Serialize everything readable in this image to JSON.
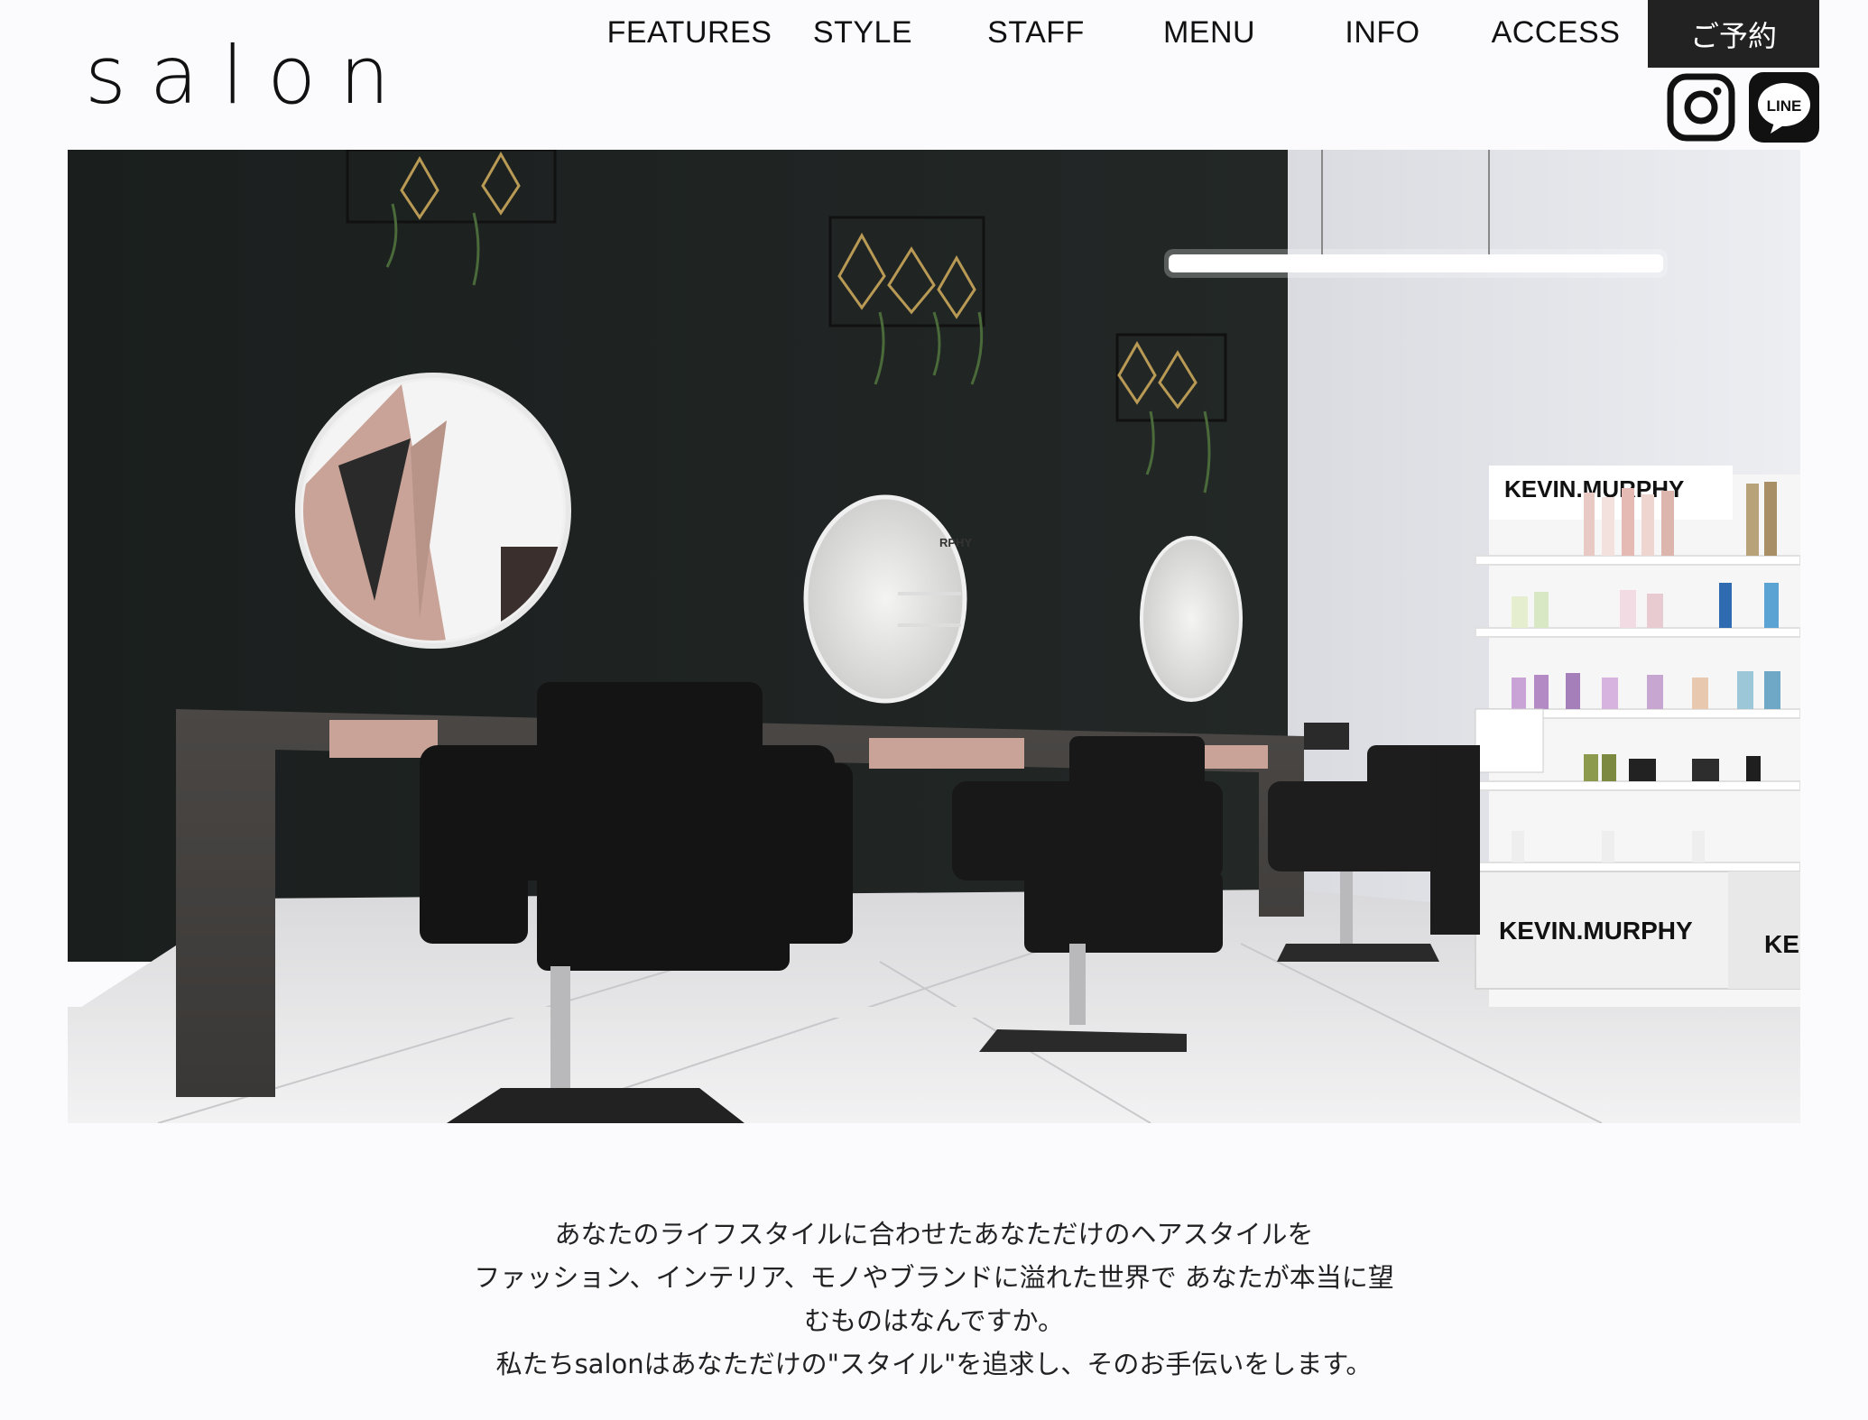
{
  "logo": {
    "text": "salon"
  },
  "nav": {
    "items": [
      {
        "label": "FEATURES"
      },
      {
        "label": "STYLE"
      },
      {
        "label": "STAFF"
      },
      {
        "label": "MENU"
      },
      {
        "label": "INFO"
      },
      {
        "label": "ACCESS"
      }
    ],
    "reserve_label": "ご予約"
  },
  "social": {
    "instagram_icon": "instagram-icon",
    "line_icon": "line-icon",
    "line_label": "LINE"
  },
  "hero": {
    "brand_sign_1": "KEVIN.MURPHY",
    "brand_sign_2": "KEVIN.MURPHY",
    "brand_sign_partial": "KE",
    "mirror_label": "RPHY"
  },
  "intro": {
    "lines": [
      "あなたのライフスタイルに合わせたあなただけのヘアスタイルを",
      "ファッション、インテリア、モノやブランドに溢れた世界で あなたが本当に望",
      "むものはなんですか。",
      "私たちsalonはあなただけの\"スタイル\"を追求し、そのお手伝いをします。"
    ]
  },
  "colors": {
    "background": "#fbfbfd",
    "text": "#111111",
    "reserve_bg": "#222222",
    "wall_dark": "#1c2120",
    "blush": "#c9a398"
  }
}
